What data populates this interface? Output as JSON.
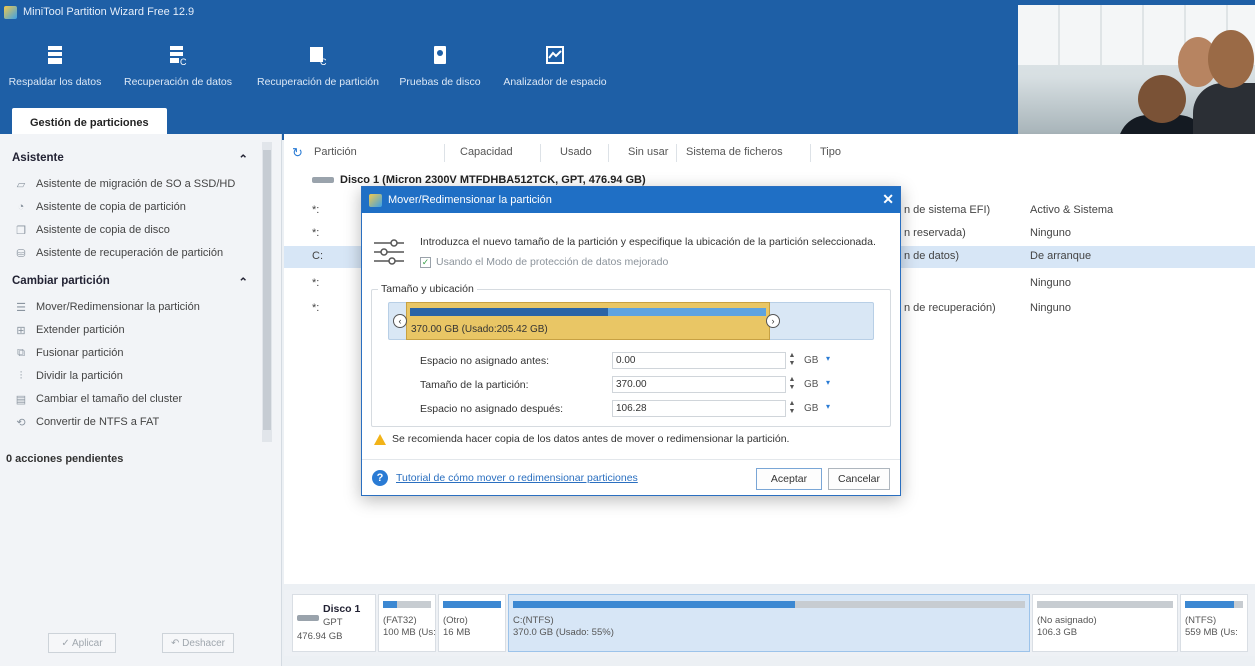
{
  "app": {
    "title": "MiniTool Partition Wizard Free 12.9"
  },
  "toolbar": [
    {
      "label": "Respaldar los datos",
      "icon": "backup-icon"
    },
    {
      "label": "Recuperación de datos",
      "icon": "data-recovery-icon"
    },
    {
      "label": "Recuperación de partición",
      "icon": "partition-recovery-icon"
    },
    {
      "label": "Pruebas de disco",
      "icon": "disk-benchmark-icon"
    },
    {
      "label": "Analizador de espacio",
      "icon": "space-analyzer-icon"
    }
  ],
  "tab": {
    "label": "Gestión de particiones"
  },
  "sidebar": {
    "asistente": {
      "title": "Asistente",
      "items": [
        {
          "label": "Asistente de migración de SO a SSD/HD",
          "icon": "migrate-os-icon"
        },
        {
          "label": "Asistente de copia de partición",
          "icon": "copy-partition-icon"
        },
        {
          "label": "Asistente de copia de disco",
          "icon": "copy-disk-icon"
        },
        {
          "label": "Asistente de recuperación de partición",
          "icon": "recover-partition-icon"
        }
      ]
    },
    "cambiar": {
      "title": "Cambiar partición",
      "items": [
        {
          "label": "Mover/Redimensionar la partición",
          "icon": "move-resize-icon"
        },
        {
          "label": "Extender partición",
          "icon": "extend-icon"
        },
        {
          "label": "Fusionar partición",
          "icon": "merge-icon"
        },
        {
          "label": "Dividir la partición",
          "icon": "split-icon"
        },
        {
          "label": "Cambiar el tamaño del cluster",
          "icon": "cluster-icon"
        },
        {
          "label": "Convertir de NTFS a FAT",
          "icon": "convert-icon"
        }
      ]
    },
    "pending": "0 acciones pendientes",
    "apply_label": "✓ Aplicar",
    "undo_label": "↶ Deshacer"
  },
  "table": {
    "headers": [
      "Partición",
      "Capacidad",
      "Usado",
      "Sin usar",
      "Sistema de ficheros",
      "Tipo"
    ],
    "disk_label": "Disco 1 (Micron 2300V MTFDHBA512TCK, GPT, 476.94 GB)",
    "rows": [
      {
        "part": "*:",
        "type_tail": "n de sistema EFI)",
        "status": "Activo & Sistema"
      },
      {
        "part": "*:",
        "type_tail": "n reservada)",
        "status": "Ninguno"
      },
      {
        "part": "C:",
        "type_tail": "n de datos)",
        "status": "De arranque"
      },
      {
        "part": "*:",
        "type_tail": "",
        "status": "Ninguno"
      },
      {
        "part": "*:",
        "type_tail": "n de recuperación)",
        "status": "Ninguno"
      }
    ],
    "selected_row": 2
  },
  "diskmap": {
    "disk": {
      "name": "Disco 1",
      "style": "GPT",
      "size": "476.94 GB"
    },
    "partitions": [
      {
        "line1": "(FAT32)",
        "line2": "100 MB (Us:",
        "used": 0.3
      },
      {
        "line1": "(Otro)",
        "line2": "16 MB",
        "used": 1.0
      },
      {
        "line1": "C:(NTFS)",
        "line2": "370.0 GB (Usado: 55%)",
        "used": 0.55
      },
      {
        "line1": "(No asignado)",
        "line2": "106.3 GB",
        "used": 0.0
      },
      {
        "line1": "(NTFS)",
        "line2": "559 MB (Us:",
        "used": 0.85
      }
    ]
  },
  "dialog": {
    "title": "Mover/Redimensionar la partición",
    "intro": "Introduzca el nuevo tamaño de la partición y especifique la ubicación de la partición seleccionada.",
    "checkbox_label": "Usando el Modo de protección de datos mejorado",
    "group_title": "Tamaño y ubicación",
    "slider": {
      "label": "370.00 GB (Usado:205.42 GB)",
      "used": 0.555
    },
    "fields": [
      {
        "label": "Espacio no asignado antes:",
        "value": "0.00",
        "unit": "GB"
      },
      {
        "label": "Tamaño de la partición:",
        "value": "370.00",
        "unit": "GB"
      },
      {
        "label": "Espacio no asignado después:",
        "value": "106.28",
        "unit": "GB"
      }
    ],
    "warning": "Se recomienda hacer copia de los datos antes de mover o redimensionar la partición.",
    "help_link": "Tutorial de cómo mover o redimensionar particiones",
    "ok_label": "Aceptar",
    "cancel_label": "Cancelar"
  },
  "colors": {
    "brand": "#1e5fa6",
    "accent": "#2a7bd4",
    "selection": "#d7e6f6",
    "partition_slider": "#e9c665"
  }
}
